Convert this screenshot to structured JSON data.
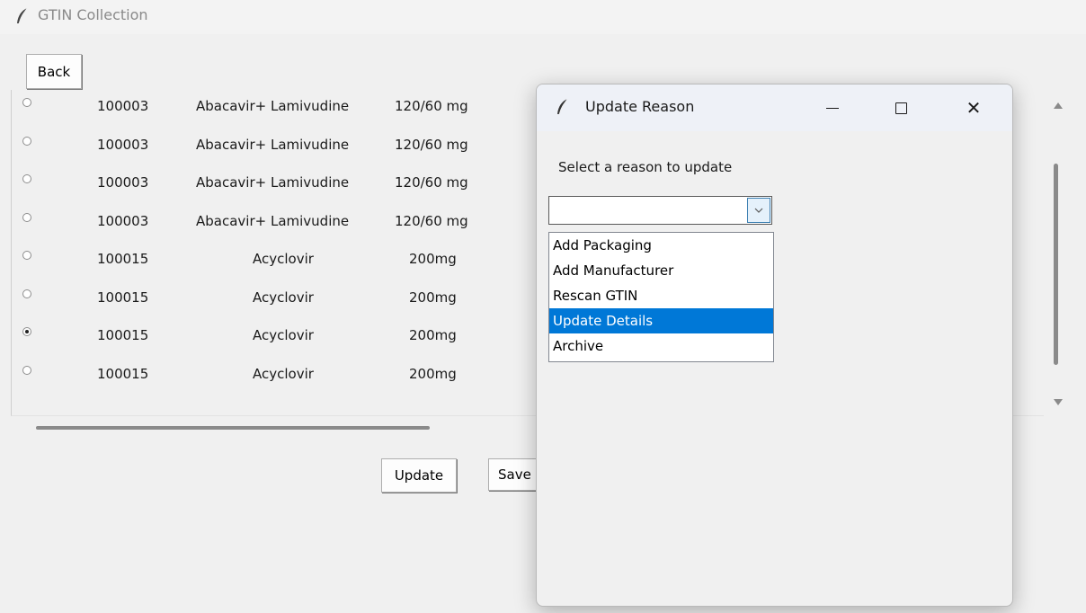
{
  "window": {
    "title": "GTIN Collection"
  },
  "buttons": {
    "back": "Back",
    "update": "Update",
    "save": "Save"
  },
  "rows": [
    {
      "selected": false,
      "code": "100003",
      "name": "Abacavir+ Lamivudine",
      "strength": "120/60 mg"
    },
    {
      "selected": false,
      "code": "100003",
      "name": "Abacavir+ Lamivudine",
      "strength": "120/60 mg"
    },
    {
      "selected": false,
      "code": "100003",
      "name": "Abacavir+ Lamivudine",
      "strength": "120/60 mg"
    },
    {
      "selected": false,
      "code": "100003",
      "name": "Abacavir+ Lamivudine",
      "strength": "120/60 mg"
    },
    {
      "selected": false,
      "code": "100015",
      "name": "Acyclovir",
      "strength": "200mg"
    },
    {
      "selected": false,
      "code": "100015",
      "name": "Acyclovir",
      "strength": "200mg"
    },
    {
      "selected": true,
      "code": "100015",
      "name": "Acyclovir",
      "strength": "200mg"
    },
    {
      "selected": false,
      "code": "100015",
      "name": "Acyclovir",
      "strength": "200mg"
    }
  ],
  "dialog": {
    "title": "Update Reason",
    "prompt": "Select a reason to update",
    "combo_value": "",
    "options": [
      "Add Packaging",
      "Add Manufacturer",
      "Rescan GTIN",
      "Update Details",
      "Archive"
    ],
    "highlighted_option": "Update Details"
  },
  "icons": {
    "app": "feather-icon",
    "minimize": "minimize-icon",
    "maximize": "maximize-icon",
    "close": "close-icon",
    "dropdown": "chevron-down-icon"
  },
  "colors": {
    "highlight": "#0078d7",
    "window_bg": "#f0f0f0",
    "dialog_titlebar": "#eef1f7"
  }
}
